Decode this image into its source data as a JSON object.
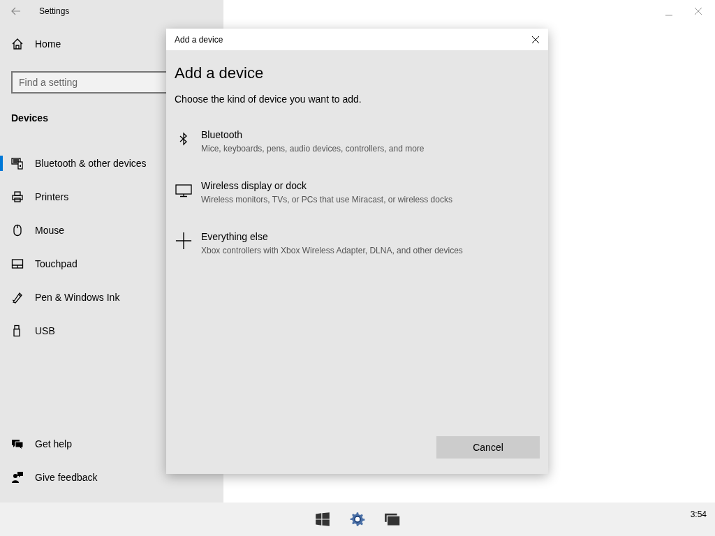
{
  "window": {
    "title": "Settings"
  },
  "sidebar": {
    "home": "Home",
    "search": {
      "placeholder": "Find a setting"
    },
    "section": "Devices",
    "items": [
      {
        "label": "Bluetooth & other devices",
        "kind": "keyboard",
        "selected": true
      },
      {
        "label": "Printers",
        "kind": "printer",
        "selected": false
      },
      {
        "label": "Mouse",
        "kind": "mouse",
        "selected": false
      },
      {
        "label": "Touchpad",
        "kind": "touchpad",
        "selected": false
      },
      {
        "label": "Pen & Windows Ink",
        "kind": "pen",
        "selected": false
      },
      {
        "label": "USB",
        "kind": "usb",
        "selected": false
      }
    ],
    "footer": [
      {
        "label": "Get help",
        "kind": "help"
      },
      {
        "label": "Give feedback",
        "kind": "feedback"
      }
    ]
  },
  "dialog": {
    "title": "Add a device",
    "heading": "Add a device",
    "subtitle": "Choose the kind of device you want to add.",
    "options": [
      {
        "kind": "bluetooth",
        "title": "Bluetooth",
        "description": "Mice, keyboards, pens, audio devices, controllers, and more"
      },
      {
        "kind": "monitor",
        "title": "Wireless display or dock",
        "description": "Wireless monitors, TVs, or PCs that use Miracast, or wireless docks"
      },
      {
        "kind": "plus",
        "title": "Everything else",
        "description": "Xbox controllers with Xbox Wireless Adapter, DLNA, and other devices"
      }
    ],
    "cancel": "Cancel"
  },
  "taskbar": {
    "apps": [
      {
        "kind": "windows"
      },
      {
        "kind": "gear"
      },
      {
        "kind": "windows-stack"
      }
    ],
    "clock": "3:54"
  }
}
